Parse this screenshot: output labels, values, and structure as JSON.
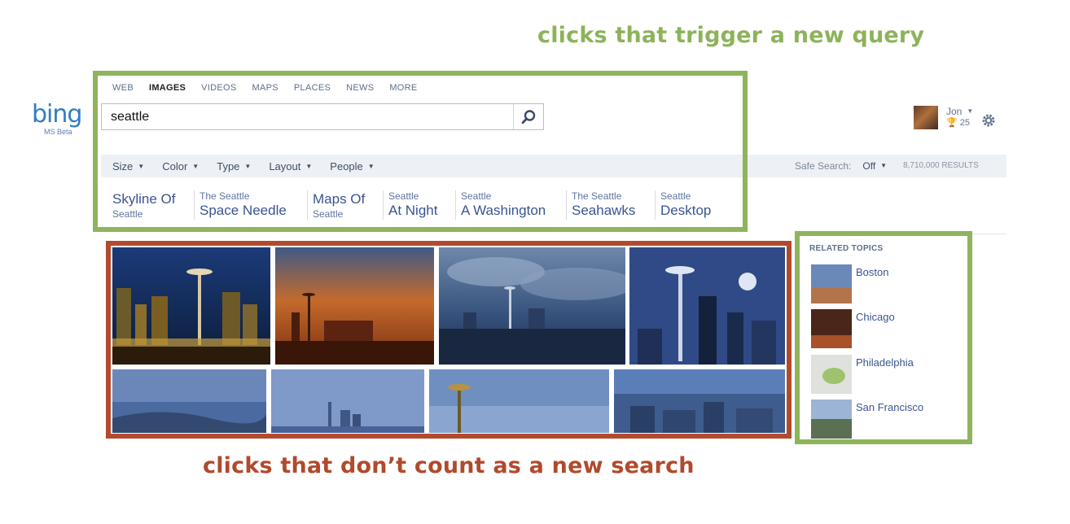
{
  "annotations": {
    "green": "clicks that trigger a new query",
    "red": "clicks that don’t count as a new search"
  },
  "logo": {
    "word": "bing",
    "sub": "MS Beta"
  },
  "tabs": [
    "WEB",
    "IMAGES",
    "VIDEOS",
    "MAPS",
    "PLACES",
    "NEWS",
    "MORE"
  ],
  "active_tab": "IMAGES",
  "search": {
    "value": "seattle"
  },
  "filters": [
    "Size",
    "Color",
    "Type",
    "Layout",
    "People"
  ],
  "safe_search": {
    "label": "Safe Search:",
    "value": "Off",
    "results": "8,710,000 RESULTS"
  },
  "related_searches": [
    {
      "big": "Skyline Of",
      "small": "Seattle",
      "order": "big-first"
    },
    {
      "small": "The Seattle",
      "big": "Space Needle",
      "order": "small-first"
    },
    {
      "big": "Maps Of",
      "small": "Seattle",
      "order": "big-first"
    },
    {
      "small": "Seattle",
      "big": "At Night",
      "order": "small-first"
    },
    {
      "small": "Seattle",
      "big": "A Washington",
      "order": "small-first"
    },
    {
      "small": "The Seattle",
      "big": "Seahawks",
      "order": "small-first"
    },
    {
      "small": "Seattle",
      "big": "Desktop",
      "order": "small-first"
    }
  ],
  "related_topics": {
    "title": "RELATED TOPICS",
    "items": [
      "Boston",
      "Chicago",
      "Philadelphia",
      "San Francisco"
    ]
  },
  "user": {
    "name": "Jon",
    "points": "25"
  },
  "icons": [
    "search-icon",
    "chevron-down-icon",
    "gear-icon",
    "avatar"
  ],
  "colors": {
    "annotation_green": "#8db35a",
    "annotation_red": "#b04a2c",
    "link": "#3a5490"
  }
}
